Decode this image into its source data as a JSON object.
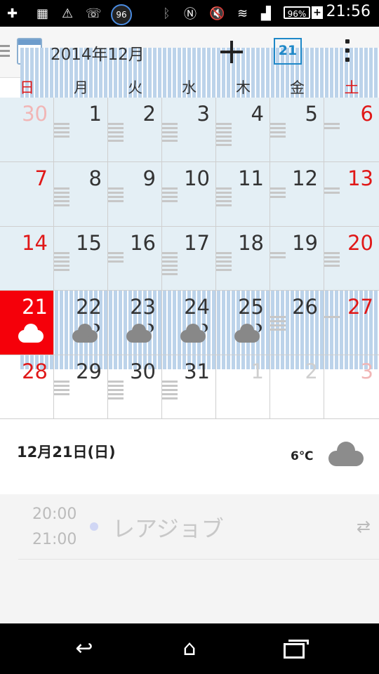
{
  "status_bar": {
    "time": "21:56",
    "battery": "96%",
    "notification_badge": "96"
  },
  "toolbar": {
    "title": "2014年12月",
    "today_label": "21"
  },
  "weekdays": [
    "日",
    "月",
    "火",
    "水",
    "木",
    "金",
    "土"
  ],
  "weeks": [
    [
      {
        "d": "30"
      },
      {
        "d": "1"
      },
      {
        "d": "2"
      },
      {
        "d": "3"
      },
      {
        "d": "4"
      },
      {
        "d": "5"
      },
      {
        "d": "6"
      }
    ],
    [
      {
        "d": "7"
      },
      {
        "d": "8"
      },
      {
        "d": "9"
      },
      {
        "d": "10"
      },
      {
        "d": "11"
      },
      {
        "d": "12"
      },
      {
        "d": "13"
      }
    ],
    [
      {
        "d": "14"
      },
      {
        "d": "15"
      },
      {
        "d": "16"
      },
      {
        "d": "17"
      },
      {
        "d": "18"
      },
      {
        "d": "19"
      },
      {
        "d": "20"
      }
    ],
    [
      {
        "d": "21",
        "today": true,
        "weather": "cloud"
      },
      {
        "d": "22",
        "weather": "cloud-moon"
      },
      {
        "d": "23",
        "weather": "cloud-moon"
      },
      {
        "d": "24",
        "weather": "cloud-moon"
      },
      {
        "d": "25",
        "weather": "cloud-moon"
      },
      {
        "d": "26"
      },
      {
        "d": "27"
      }
    ],
    [
      {
        "d": "28"
      },
      {
        "d": "29"
      },
      {
        "d": "30"
      },
      {
        "d": "31"
      },
      {
        "d": "1",
        "other": true
      },
      {
        "d": "2",
        "other": true
      },
      {
        "d": "3",
        "other": true
      }
    ]
  ],
  "detail": {
    "date": "12月21日(日)",
    "temperature": "6℃",
    "weather_icon": "cloud-icon"
  },
  "events": [
    {
      "start": "20:00",
      "end": "21:00",
      "title": "レアジョブ",
      "repeat_icon": "repeat-icon"
    }
  ],
  "colors": {
    "today_bg": "#f5000a",
    "past_bg": "#e4eff5",
    "sunday_saturday": "#e01818",
    "accent": "#1e88c8"
  }
}
